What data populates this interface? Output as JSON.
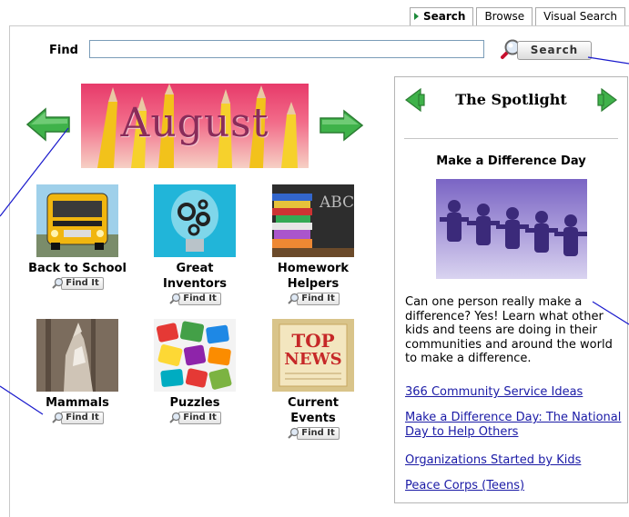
{
  "tabs": [
    {
      "label": "Search",
      "active": true
    },
    {
      "label": "Browse",
      "active": false
    },
    {
      "label": "Visual Search",
      "active": false
    }
  ],
  "find": {
    "label": "Find",
    "value": "",
    "placeholder": "",
    "search_label": "Search"
  },
  "banner": {
    "month": "August"
  },
  "tiles": [
    {
      "caption": "Back to School",
      "findit": "Find It"
    },
    {
      "caption": "Great Inventors",
      "findit": "Find It"
    },
    {
      "caption": "Homework Helpers",
      "findit": "Find It"
    },
    {
      "caption": "Mammals",
      "findit": "Find It"
    },
    {
      "caption": "Puzzles",
      "findit": "Find It"
    },
    {
      "caption": "Current Events",
      "findit": "Find It"
    }
  ],
  "tile_images": {
    "homework_abc": "ABC",
    "news_top": "TOP",
    "news_news": "NEWS"
  },
  "spotlight": {
    "title": "The Spotlight",
    "subtitle": "Make a Difference Day",
    "description": "Can one person really make a difference? Yes! Learn what other kids and teens are doing in their communities and around the world to make a difference.",
    "links": [
      "366 Community Service Ideas",
      "Make a Difference Day: The National Day to Help Others",
      "Organizations Started by Kids",
      "Peace Corps (Teens)"
    ]
  },
  "colors": {
    "arrow_green": "#3fb24a",
    "link_blue": "#1a1aa6",
    "annotation_line": "#1a1acc"
  },
  "icons": [
    "magnifier-icon",
    "arrow-left-icon",
    "arrow-right-icon"
  ]
}
